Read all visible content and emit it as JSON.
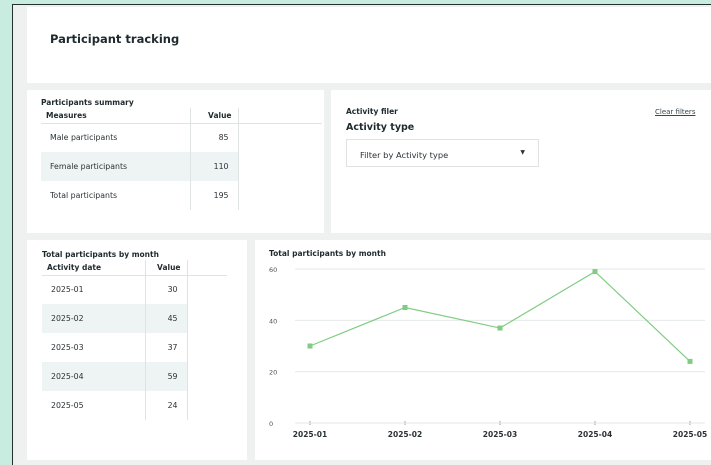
{
  "header": {
    "title": "Participant tracking"
  },
  "summary": {
    "title": "Participants summary",
    "columns": [
      "Measures",
      "Value"
    ],
    "rows": [
      {
        "label": "Male participants",
        "value": "85"
      },
      {
        "label": "Female participants",
        "value": "110"
      },
      {
        "label": "Total participants",
        "value": "195"
      }
    ]
  },
  "filter": {
    "section_title": "Activity filer",
    "clear_label": "Clear filters",
    "field_label": "Activity type",
    "dropdown_value": "Filter by Activity type",
    "dropdown_arrow": "▼"
  },
  "monthly_table": {
    "title": "Total participants by month",
    "columns": [
      "Activity date",
      "Value"
    ],
    "rows": [
      {
        "date": "2025-01",
        "value": "30"
      },
      {
        "date": "2025-02",
        "value": "45"
      },
      {
        "date": "2025-03",
        "value": "37"
      },
      {
        "date": "2025-04",
        "value": "59"
      },
      {
        "date": "2025-05",
        "value": "24"
      }
    ]
  },
  "chart_data": {
    "type": "line",
    "title": "Total participants by month",
    "xlabel": "",
    "ylabel": "",
    "x": [
      "2025-01",
      "2025-02",
      "2025-03",
      "2025-04",
      "2025-05"
    ],
    "series": [
      {
        "values": [
          30,
          45,
          37,
          59,
          24
        ]
      }
    ],
    "ylim": [
      0,
      60
    ],
    "yticks": [
      0,
      20,
      40,
      60
    ],
    "grid": true,
    "color": "#7fcc82"
  }
}
